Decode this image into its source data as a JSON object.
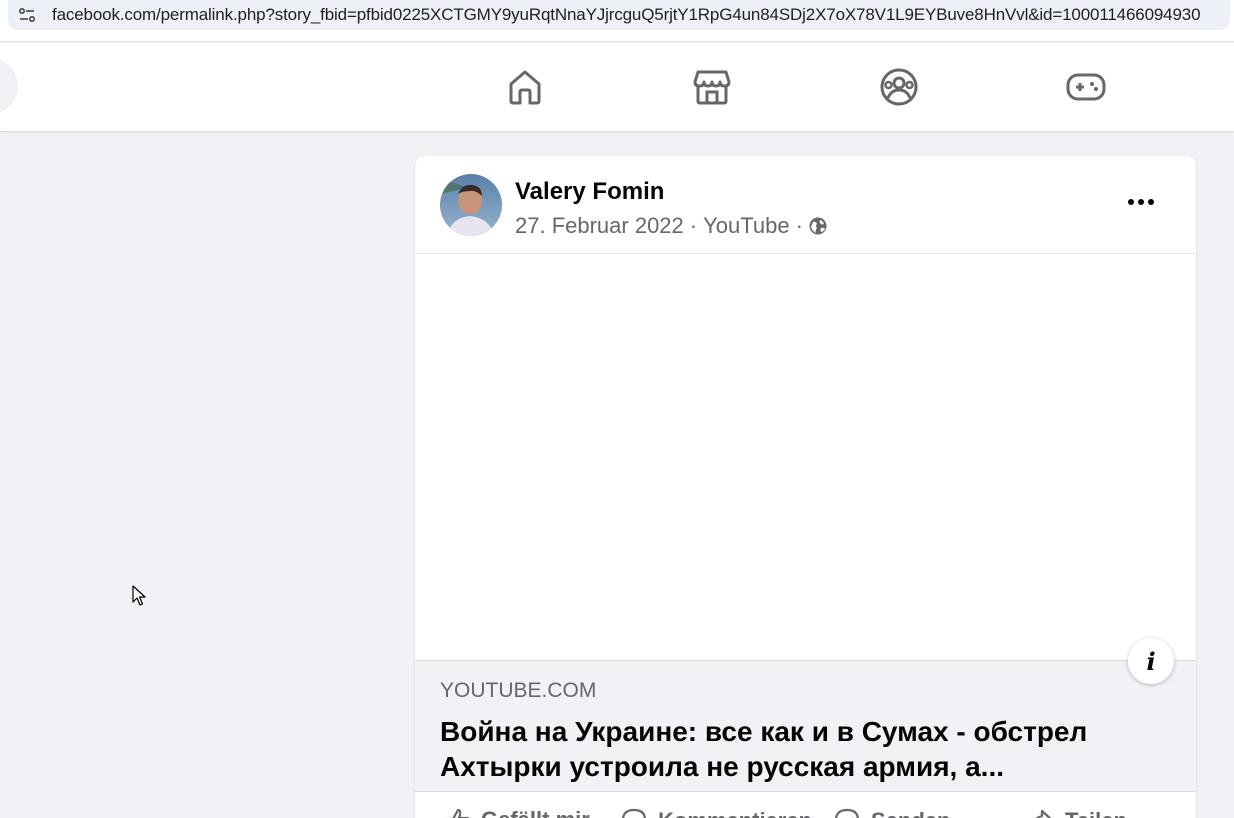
{
  "browser": {
    "url": "facebook.com/permalink.php?story_fbid=pfbid0225XCTGMY9yuRqtNnaYJjrcguQ5rjtY1RpG4un84SDj2X7oX78V1L9EYBuve8HnVvl&id=100011466094930"
  },
  "nav": {
    "icons": [
      "home-icon",
      "marketplace-icon",
      "groups-icon",
      "gaming-icon"
    ]
  },
  "post": {
    "author": "Valery Fomin",
    "date": "27. Februar 2022",
    "separator": "·",
    "source": "YouTube",
    "link": {
      "domain": "YOUTUBE.COM",
      "title": "Война на Украине: все как и в Сумах - обстрел Ахтырки устроила не русская армия, а..."
    },
    "actions": {
      "like": "Gefällt mir",
      "comment": "Kommentieren",
      "send": "Senden",
      "share": "Teilen"
    }
  },
  "colors": {
    "background": "#f0f2f5",
    "secondary_text": "#65676b",
    "primary_text": "#050505"
  }
}
